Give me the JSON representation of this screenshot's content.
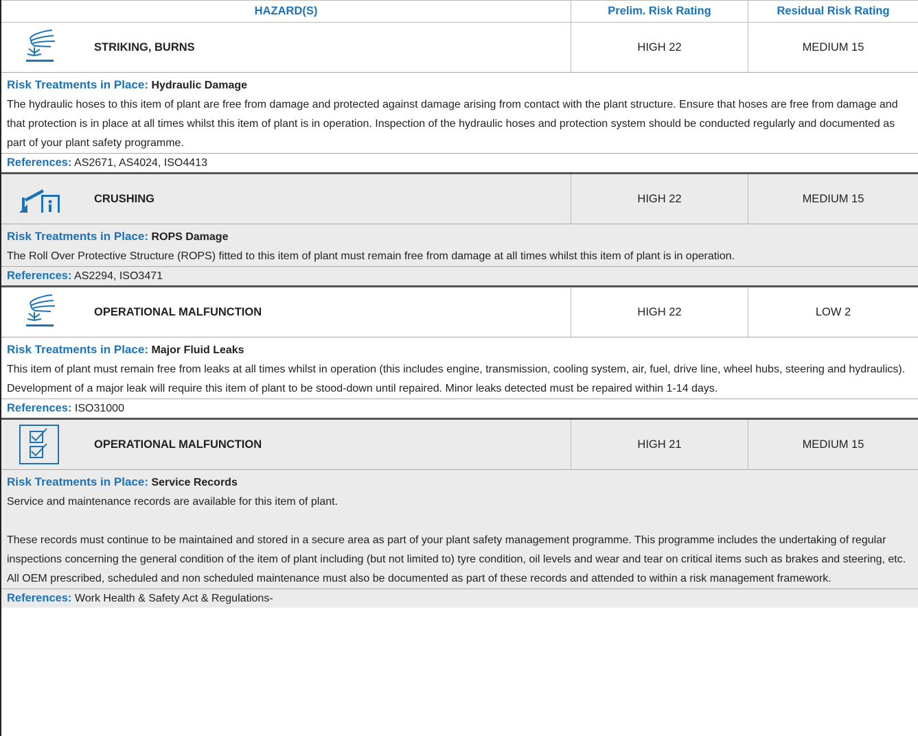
{
  "header": {
    "hazard_label": "HAZARD(S)",
    "prelim_label": "Prelim. Risk Rating",
    "residual_label": "Residual Risk Rating"
  },
  "labels": {
    "treatments": "Risk Treatments in Place:",
    "references": "References:"
  },
  "colors": {
    "accent": "#1a73b8",
    "grey_block": "#ebebeb"
  },
  "hazards": [
    {
      "icon": "hydraulic-icon",
      "name": "STRIKING, BURNS",
      "prelim": "HIGH 22",
      "residual": "MEDIUM 15",
      "treatment_title": "Hydraulic Damage",
      "paragraphs": [
        "The hydraulic hoses to this item of plant are free from damage and protected against damage arising from contact with the plant structure. Ensure that hoses are free from damage and that  protection is in place at all times whilst this item of plant is in operation. Inspection of the hydraulic hoses and  protection system should be conducted regularly and documented as part of your plant safety programme."
      ],
      "references": "AS2671, AS4024, ISO4413"
    },
    {
      "icon": "rops-crushing-icon",
      "name": "CRUSHING",
      "prelim": "HIGH 22",
      "residual": "MEDIUM 15",
      "treatment_title": "ROPS Damage",
      "paragraphs": [
        "The Roll Over Protective Structure (ROPS) fitted to this item of plant must remain free from damage at all times whilst this item of plant is in operation."
      ],
      "references": "AS2294, ISO3471"
    },
    {
      "icon": "hydraulic-icon",
      "name": "OPERATIONAL MALFUNCTION",
      "prelim": "HIGH 22",
      "residual": "LOW 2",
      "treatment_title": "Major Fluid Leaks",
      "paragraphs": [
        "This item of plant must remain free from leaks at all times whilst in operation (this includes engine, transmission, cooling system, air, fuel, drive line, wheel hubs, steering and hydraulics). Development of a major leak will require this item of plant to be stood-down until repaired. Minor leaks detected must be repaired within 1-14 days."
      ],
      "references": "ISO31000"
    },
    {
      "icon": "checklist-icon",
      "name": "OPERATIONAL MALFUNCTION",
      "prelim": "HIGH 21",
      "residual": "MEDIUM 15",
      "treatment_title": "Service Records",
      "paragraphs": [
        "Service and maintenance records are available for this item of plant.",
        "These records must continue to be maintained and stored in a secure area as part of your plant safety management programme. This programme includes the undertaking of regular inspections concerning the general condition of the item of plant including (but not limited to) tyre condition, oil levels and wear and tear on critical items such as brakes and steering, etc. All OEM prescribed, scheduled and non scheduled maintenance must also be documented as part of these records and attended to within a risk management framework."
      ],
      "references": "Work Health & Safety Act & Regulations-"
    }
  ]
}
